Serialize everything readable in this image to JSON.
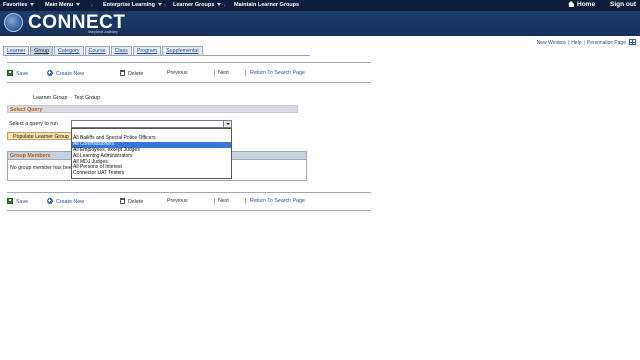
{
  "topnav": {
    "items": [
      {
        "label": "Favorites"
      },
      {
        "label": "Main Menu"
      },
      {
        "label": "Enterprise Learning"
      },
      {
        "label": "Learner Groups"
      },
      {
        "label": "Maintain Learner Groups"
      }
    ],
    "home": "Home",
    "signout": "Sign out"
  },
  "brand": {
    "title": "CONNECT",
    "subtitle": "Maryland Judiciary"
  },
  "util_links": {
    "new_window": "New Window",
    "help": "Help",
    "personalize": "Personalize Page"
  },
  "tabs": [
    {
      "label": "Learner",
      "active": false
    },
    {
      "label": "Group",
      "active": true
    },
    {
      "label": "Category",
      "active": false
    },
    {
      "label": "Course",
      "active": false
    },
    {
      "label": "Class",
      "active": false
    },
    {
      "label": "Program",
      "active": false
    },
    {
      "label": "Supplemental",
      "active": false
    }
  ],
  "toolbar": {
    "save": "Save",
    "create_new": "Create New",
    "delete": "Delete",
    "previous": "Previous",
    "next": "Next",
    "return_search": "Return To Search Page"
  },
  "form": {
    "learner_group_label": "Learner Group",
    "learner_group_value": "Test Group",
    "select_query_header": "Select Query",
    "select_query_label": "Select a query to run",
    "select_value": "",
    "populate_button": "Populate Learner Group"
  },
  "query_options": [
    {
      "label": "",
      "selected": false
    },
    {
      "label": "All Bailiffs and Special Police Officers",
      "selected": false
    },
    {
      "label": "All Commissioners",
      "selected": true
    },
    {
      "label": "All Employees, except Judges",
      "selected": false
    },
    {
      "label": "All Learning Administrators",
      "selected": false
    },
    {
      "label": "All MDJ Judges",
      "selected": false
    },
    {
      "label": "All Persons of Interest",
      "selected": false
    },
    {
      "label": "Connector UAT Testers",
      "selected": false
    }
  ],
  "group_members": {
    "title": "Group Members",
    "empty_text": "No group member has been added."
  },
  "colors": {
    "topbar": "#0e1e3a",
    "brandbar": "#1d3d6b",
    "link": "#1f4e9a",
    "section_header_text": "#c45a00",
    "selected_option": "#3478d6"
  }
}
